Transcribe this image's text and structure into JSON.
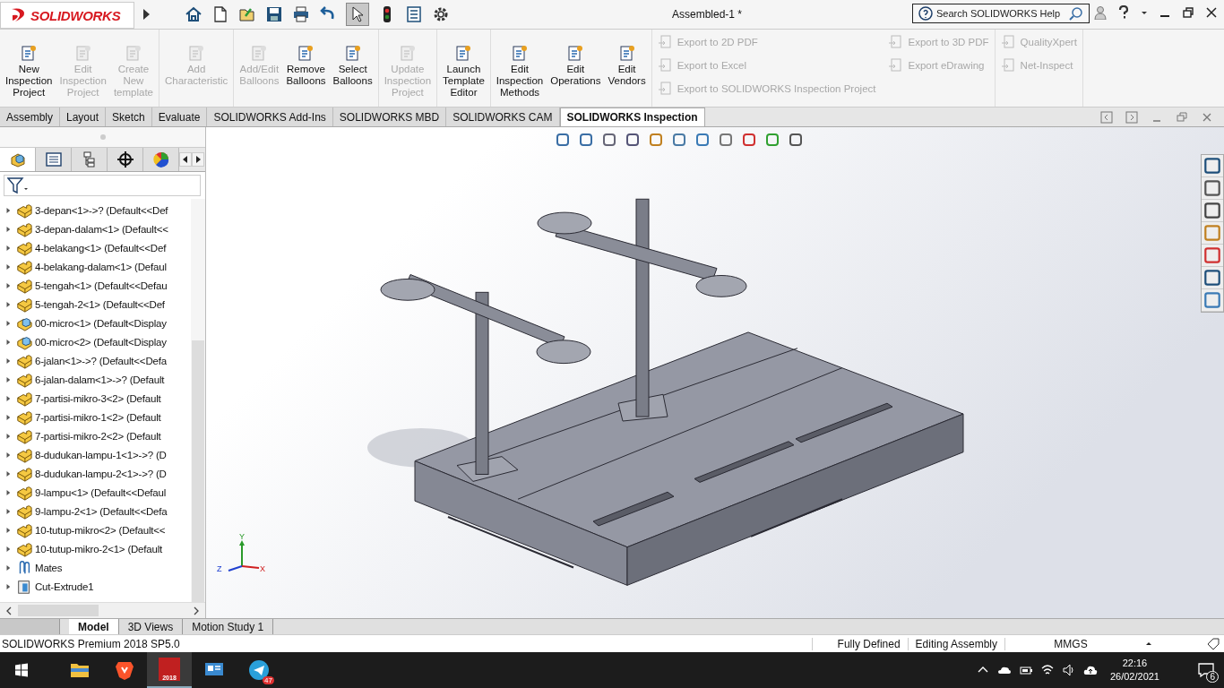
{
  "title_bar": {
    "app_name": "SOLIDWORKS",
    "document": "Assembled-1 *",
    "search": {
      "placeholder": "Search SOLIDWORKS Help"
    },
    "select_tool": {
      "selected": true
    }
  },
  "ribbon": {
    "groups": [
      [
        {
          "lines": [
            "New",
            "Inspection",
            "Project"
          ],
          "disabled": false
        },
        {
          "lines": [
            "Edit",
            "Inspection",
            "Project"
          ],
          "disabled": true
        },
        {
          "lines": [
            "Create",
            "New",
            "template"
          ],
          "disabled": true
        }
      ],
      [
        {
          "lines": [
            "Add",
            "Characteristic"
          ],
          "disabled": true
        }
      ],
      [
        {
          "lines": [
            "Add/Edit",
            "Balloons"
          ],
          "disabled": true
        },
        {
          "lines": [
            "Remove",
            "Balloons"
          ],
          "disabled": false
        },
        {
          "lines": [
            "Select",
            "Balloons"
          ],
          "disabled": false
        }
      ],
      [
        {
          "lines": [
            "Update",
            "Inspection",
            "Project"
          ],
          "disabled": true
        }
      ],
      [
        {
          "lines": [
            "Launch",
            "Template",
            "Editor"
          ],
          "disabled": false
        }
      ],
      [
        {
          "lines": [
            "Edit",
            "Inspection",
            "Methods"
          ],
          "disabled": false
        },
        {
          "lines": [
            "Edit",
            "Operations"
          ],
          "disabled": false
        },
        {
          "lines": [
            "Edit",
            "Vendors"
          ],
          "disabled": false
        }
      ]
    ],
    "list_groups": [
      [
        [
          {
            "label": "Export to 2D PDF",
            "disabled": true
          },
          {
            "label": "Export to Excel",
            "disabled": true
          },
          {
            "label": "Export to SOLIDWORKS Inspection Project",
            "disabled": true
          }
        ],
        [
          {
            "label": "Export to 3D PDF",
            "disabled": true
          },
          {
            "label": "Export eDrawing",
            "disabled": true
          }
        ]
      ],
      [
        [
          {
            "label": "QualityXpert",
            "disabled": true
          },
          {
            "label": "Net-Inspect",
            "disabled": true
          }
        ]
      ]
    ]
  },
  "command_tabs": [
    {
      "label": "Assembly",
      "selected": false
    },
    {
      "label": "Layout",
      "selected": false
    },
    {
      "label": "Sketch",
      "selected": false
    },
    {
      "label": "Evaluate",
      "selected": false
    },
    {
      "label": "SOLIDWORKS Add-Ins",
      "selected": false
    },
    {
      "label": "SOLIDWORKS MBD",
      "selected": false
    },
    {
      "label": "SOLIDWORKS CAM",
      "selected": false
    },
    {
      "label": "SOLIDWORKS Inspection",
      "selected": true
    }
  ],
  "panel_tabs": [
    {
      "kind": "feature",
      "selected": true
    },
    {
      "kind": "property",
      "selected": false
    },
    {
      "kind": "config",
      "selected": false
    },
    {
      "kind": "dim",
      "selected": false
    },
    {
      "kind": "appearance",
      "selected": false
    }
  ],
  "tree": [
    {
      "label": "3-depan<1>->? (Default<<Def",
      "kind": "part",
      "expanded": false
    },
    {
      "label": "3-depan-dalam<1> (Default<<",
      "kind": "part",
      "expanded": false
    },
    {
      "label": "4-belakang<1> (Default<<Def",
      "kind": "part",
      "expanded": false
    },
    {
      "label": "4-belakang-dalam<1> (Defaul",
      "kind": "part",
      "expanded": false
    },
    {
      "label": "5-tengah<1> (Default<<Defau",
      "kind": "part",
      "expanded": false
    },
    {
      "label": "5-tengah-2<1> (Default<<Def",
      "kind": "part",
      "expanded": false
    },
    {
      "label": "00-micro<1> (Default<Display",
      "kind": "subassembly",
      "expanded": false
    },
    {
      "label": "00-micro<2> (Default<Display",
      "kind": "subassembly",
      "expanded": false
    },
    {
      "label": "6-jalan<1>->? (Default<<Defa",
      "kind": "part",
      "expanded": false
    },
    {
      "label": "6-jalan-dalam<1>->? (Default",
      "kind": "part",
      "expanded": false
    },
    {
      "label": "7-partisi-mikro-3<2> (Default",
      "kind": "part",
      "expanded": false
    },
    {
      "label": "7-partisi-mikro-1<2> (Default",
      "kind": "part",
      "expanded": false
    },
    {
      "label": "7-partisi-mikro-2<2> (Default",
      "kind": "part",
      "expanded": false
    },
    {
      "label": "8-dudukan-lampu-1<1>->? (D",
      "kind": "part",
      "expanded": false
    },
    {
      "label": "8-dudukan-lampu-2<1>->? (D",
      "kind": "part",
      "expanded": false
    },
    {
      "label": "9-lampu<1> (Default<<Defaul",
      "kind": "part",
      "expanded": false
    },
    {
      "label": "9-lampu-2<1> (Default<<Defa",
      "kind": "part",
      "expanded": false
    },
    {
      "label": "10-tutup-mikro<2> (Default<<",
      "kind": "part",
      "expanded": false
    },
    {
      "label": "10-tutup-mikro-2<1> (Default",
      "kind": "part",
      "expanded": false
    },
    {
      "label": "Mates",
      "kind": "mates",
      "expanded": false
    },
    {
      "label": "Cut-Extrude1",
      "kind": "feature",
      "expanded": false
    }
  ],
  "triad": {
    "x": "X",
    "y": "Y",
    "z": "Z"
  },
  "bottom_tabs": [
    {
      "label": "Model",
      "selected": true
    },
    {
      "label": "3D Views",
      "selected": false
    },
    {
      "label": "Motion Study 1",
      "selected": false
    }
  ],
  "status_bar": {
    "product": "SOLIDWORKS Premium 2018 SP5.0",
    "fields": [
      "Fully Defined",
      "Editing Assembly",
      "MMGS"
    ]
  },
  "taskbar": {
    "apps": [
      {
        "kind": "folder",
        "active": false
      },
      {
        "kind": "browser",
        "active": false
      },
      {
        "kind": "cad",
        "active": true,
        "label": "2018"
      },
      {
        "kind": "remote",
        "active": false
      },
      {
        "kind": "messenger",
        "active": false,
        "badge": "47"
      }
    ],
    "time": "22:16",
    "date": "26/02/2021",
    "notifications": "6"
  }
}
